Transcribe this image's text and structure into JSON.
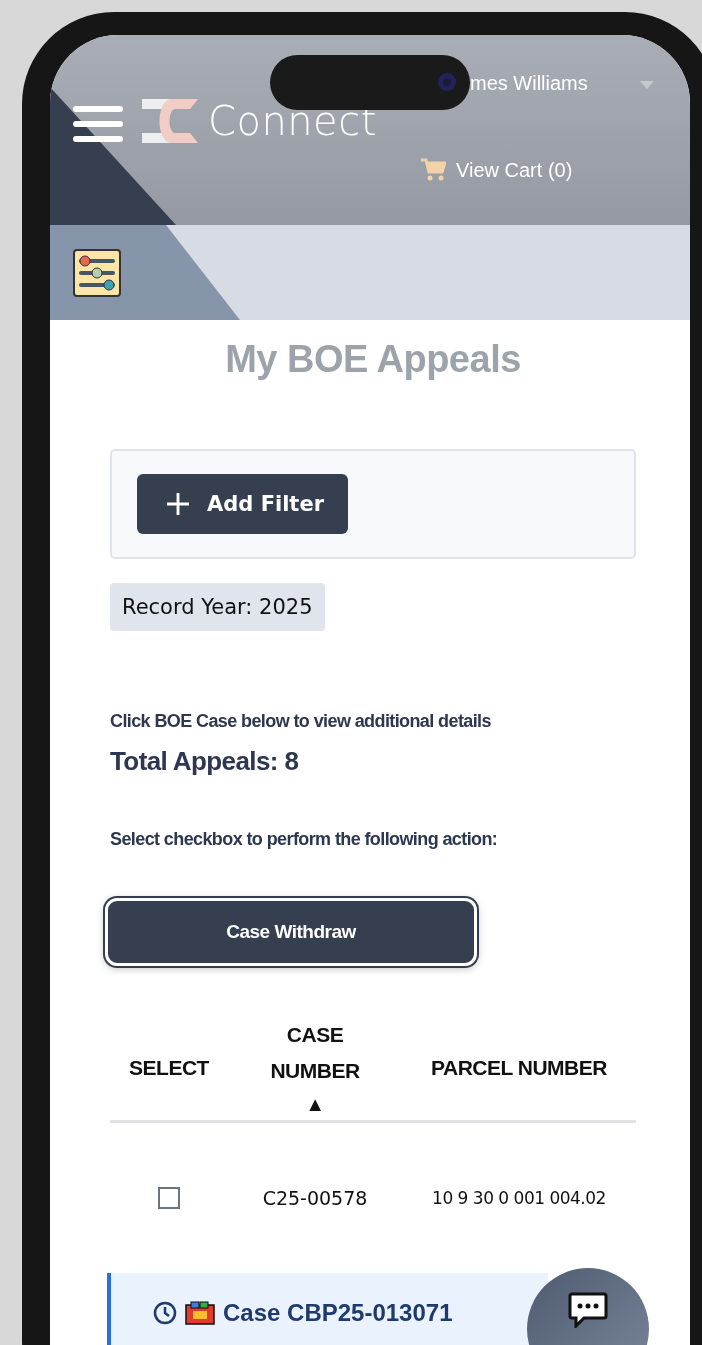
{
  "header": {
    "logo_text": "Connect",
    "user_name": "mes Williams",
    "cart_label": "View Cart (0)"
  },
  "page_title": "My BOE Appeals",
  "filter_panel": {
    "add_button": "Add Filter"
  },
  "active_filters": [
    {
      "label": "Record Year: 2025"
    }
  ],
  "instruction": "Click BOE Case below to view additional details",
  "total": "Total Appeals: 8",
  "action_hint": "Select checkbox to perform the following action:",
  "action_button": "Case Withdraw",
  "table": {
    "columns": [
      {
        "label": "SELECT"
      },
      {
        "label": "CASE NUMBER",
        "sort_indicator": "▲"
      },
      {
        "label": "PARCEL NUMBER"
      }
    ],
    "rows": [
      {
        "checked": false,
        "case_number": "C25-00578",
        "parcel_number": "10 9 30 0 001 004.02"
      }
    ]
  },
  "case_card": {
    "title": "Case CBP25-013071"
  }
}
